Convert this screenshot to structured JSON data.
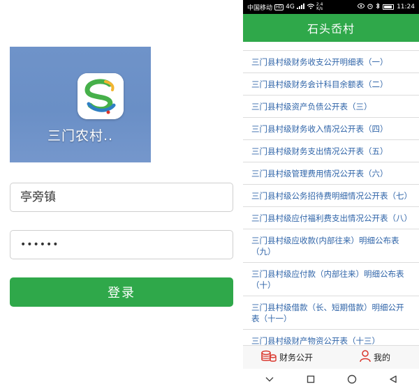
{
  "login": {
    "app_name": "三门农村..",
    "username_value": "亭旁镇",
    "password_value": "••••••",
    "login_button": "登录"
  },
  "phone": {
    "status_bar": {
      "carrier": "中国移动",
      "network_badge": "HD",
      "signal_text": "4G",
      "speed_value": "2.4",
      "speed_unit": "K/s",
      "time": "11:24"
    },
    "header_title": "石头岙村",
    "report_list": [
      "三门县村级财务收支公开明细表（一）",
      "三门县村级财务会计科目余额表（二）",
      "三门县村级资产负债公开表（三）",
      "三门县村级财务收入情况公开表（四）",
      "三门县村级财务支出情况公开表（五）",
      "三门县村级管理费用情况公开表（六）",
      "三门县村级公务招待费明细情况公开表（七）",
      "三门县村级应付福利费支出情况公开表（八）",
      "三门县村级应收款(内部往来）明细公布表（九）",
      "三门县村级应付款（内部往来）明细公布表（十）",
      "三门县村级借款（长、短期借款）明细公开表（十一）",
      "三门县村级财产物资公开表（十三）"
    ],
    "tabs": {
      "finance": "财务公开",
      "mine": "我的"
    },
    "colors": {
      "accent_green": "#2fa84a",
      "link_blue": "#2f64a8",
      "finance_icon_red": "#d9352b"
    }
  }
}
